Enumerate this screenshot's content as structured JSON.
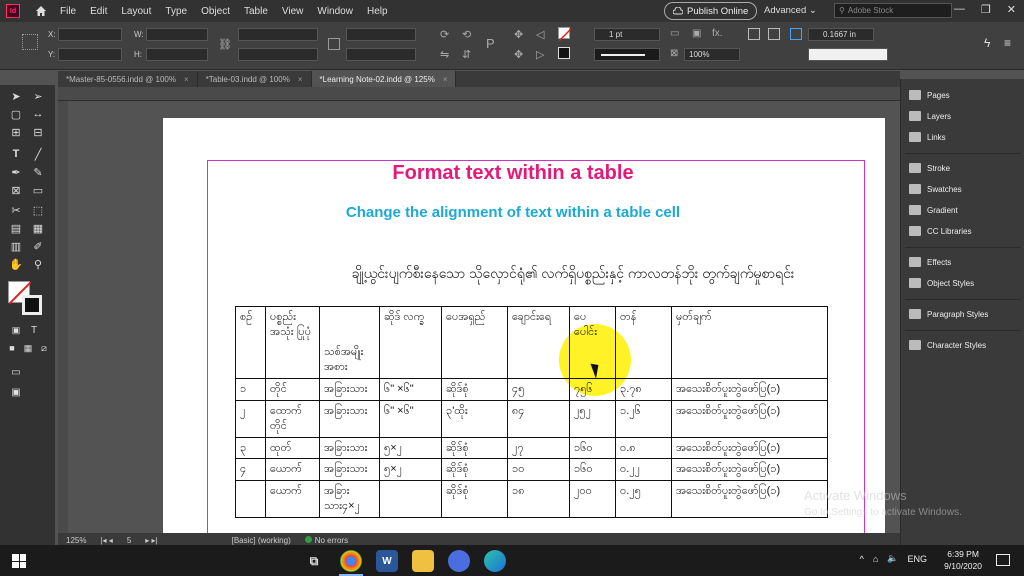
{
  "app": {
    "logo_text": "Id",
    "menu": [
      "File",
      "Edit",
      "Layout",
      "Type",
      "Object",
      "Table",
      "View",
      "Window",
      "Help"
    ],
    "publish_label": "Publish Online",
    "workspace_label": "Advanced",
    "stock_placeholder": "Adobe Stock",
    "window_controls": [
      "—",
      "❒",
      "✕"
    ]
  },
  "controlbar": {
    "x_label": "X:",
    "y_label": "Y:",
    "w_label": "W:",
    "h_label": "H:",
    "stroke_weight": "1 pt",
    "scale_percent": "100%",
    "offset_value": "0.1667 in",
    "fx_label": "fx."
  },
  "tabs": [
    {
      "label": "*Master-85-0556.indd @ 100%",
      "active": false
    },
    {
      "label": "*Table-03.indd @ 100%",
      "active": false
    },
    {
      "label": "*Learning Note-02.indd @ 125%",
      "active": true
    }
  ],
  "document": {
    "title": "Format text within a table",
    "subtitle": "Change the alignment of text within a table cell",
    "table_heading": "ချို့ယွင်းပျက်စီးနေသော သိုလှောင်ရုံ၏ လက်ရှိပစ္စည်းနှင့် ကာလတန်ဘိုး တွက်ချက်မှုစာရင်း",
    "table": {
      "header": [
        "စဉ်",
        "ပစ္စည်း အသုံး ပြုပုံ",
        "သစ်အမျိုး အစား",
        "ဆိုဒ် လက္ခ",
        "ပေအရှည်",
        "ချောင်းရေ",
        "ပေ ပေါင်း",
        "တန်",
        "မှတ်ချက်"
      ],
      "rows": [
        [
          "၁",
          "တိုင်",
          "အခြားသား",
          "၆\" ×၆\"",
          "ဆိုဒ်စုံ",
          "၄၅",
          "၇၅၆",
          "၃.၇၈",
          "အသေးစိတ်ပူးတွဲဖော်ပြ(၁)"
        ],
        [
          "၂",
          "ထောက် တိုင်",
          "အခြားသား",
          "၆\" ×၆\"",
          "၃'ထိုး",
          "၈၄",
          "၂၅၂",
          "၁.၂၆",
          "အသေးစိတ်ပူးတွဲဖော်ပြ(၁)"
        ],
        [
          "၃",
          "ထုတ်",
          "အခြားသား",
          "၅×၂",
          "ဆိုဒ်စုံ",
          "၂၇",
          "၁၆၀",
          "၀.၈",
          "အသေးစိတ်ပူးတွဲဖော်ပြ(၁)"
        ],
        [
          "၄",
          "ယောက်",
          "အခြားသား",
          "၅×၂",
          "ဆိုဒ်စုံ",
          "၁၀",
          "၁၆၀",
          "၀.၂၂",
          "အသေးစိတ်ပူးတွဲဖော်ပြ(၁)"
        ],
        [
          "",
          "ယောက်",
          "အခြား သား၄×၂",
          "",
          "ဆိုဒ်စုံ",
          "၁၈",
          "၂၀၀",
          "၀.၂၅",
          "အသေးစိတ်ပူးတွဲဖော်ပြ(၁)"
        ]
      ]
    }
  },
  "panel": {
    "items": [
      "Pages",
      "Layers",
      "Links",
      "Stroke",
      "Swatches",
      "Gradient",
      "CC Libraries",
      "Effects",
      "Object Styles",
      "Paragraph Styles",
      "Character Styles"
    ]
  },
  "status": {
    "zoom": "125%",
    "page": "5",
    "style": "[Basic] (working)",
    "errors": "No errors"
  },
  "watermark": {
    "line1": "Activate Windows",
    "line2": "Go to Settings to activate Windows."
  },
  "taskbar": {
    "time": "6:39 PM",
    "date": "9/10/2020",
    "lang": "ENG"
  }
}
